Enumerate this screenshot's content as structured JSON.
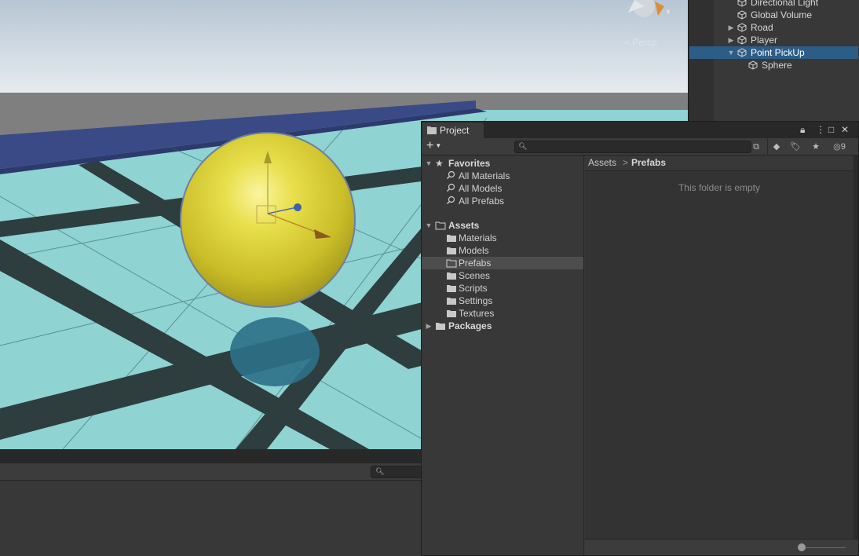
{
  "scene": {
    "view_label": "< Persp",
    "gizmo_axis_label": "x"
  },
  "hierarchy": {
    "items": [
      {
        "label": "Directional Light",
        "expandable": false,
        "selected": false
      },
      {
        "label": "Global Volume",
        "expandable": false,
        "selected": false
      },
      {
        "label": "Road",
        "expandable": true,
        "selected": false
      },
      {
        "label": "Player",
        "expandable": true,
        "selected": false
      },
      {
        "label": "Point PickUp",
        "expandable": true,
        "expanded": true,
        "selected": true
      },
      {
        "label": "Sphere",
        "expandable": false,
        "selected": false,
        "child": true
      }
    ]
  },
  "project": {
    "tab_label": "Project",
    "add_button": "+",
    "search_placeholder": "",
    "hidden_count": "9",
    "favorites": {
      "label": "Favorites",
      "items": [
        "All Materials",
        "All Models",
        "All Prefabs"
      ]
    },
    "assets": {
      "label": "Assets",
      "items": [
        "Materials",
        "Models",
        "Prefabs",
        "Scenes",
        "Scripts",
        "Settings",
        "Textures"
      ],
      "selected": "Prefabs"
    },
    "packages": {
      "label": "Packages"
    },
    "breadcrumb": {
      "root": "Assets",
      "separator": ">",
      "current": "Prefabs"
    },
    "empty_message": "This folder is empty",
    "icon_size_level": 0
  },
  "colors": {
    "selection": "#2c5d87",
    "tree_selection": "#4d4d4d",
    "sphere": "#d9d23a",
    "floor": "#8fd3d3"
  }
}
